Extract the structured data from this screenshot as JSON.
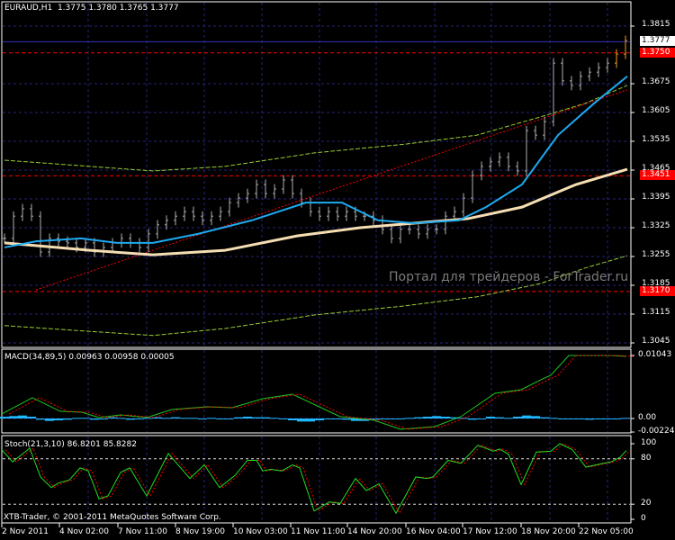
{
  "header": {
    "symbol": "EURAUD,H1",
    "open": "1.3775",
    "high": "1.3780",
    "low": "1.3765",
    "close": "1.3777"
  },
  "watermark": "Портал для трейдеров - ForTrader.ru",
  "copyright": "XTB-Trader, © 2001-2011 MetaQuotes Software Corp.",
  "colors": {
    "bars": "#b0b0b0",
    "fast_ma": "#1eaaf0",
    "slow_ma": "#f5deb3",
    "bands": "#9acd32",
    "levels": "#ff0000",
    "grid": "#25257a",
    "macd": "#1ec81e",
    "hist": "#20b8ff",
    "signal": "#ff0000"
  },
  "chart_data": [
    {
      "type": "ohlc",
      "title": "EURAUD,H1",
      "ylim": [
        1.3045,
        1.3815
      ],
      "yticks": [
        "1.3815",
        "1.3675",
        "1.3605",
        "1.3535",
        "1.3465",
        "1.3395",
        "1.3325",
        "1.3255",
        "1.3185",
        "1.3115",
        "1.3045"
      ],
      "xticks": [
        "2 Nov 2011",
        "4 Nov 02:00",
        "7 Nov 11:00",
        "8 Nov 19:00",
        "10 Nov 03:00",
        "11 Nov 11:00",
        "14 Nov 20:00",
        "16 Nov 04:00",
        "17 Nov 12:00",
        "18 Nov 20:00",
        "22 Nov 05:00"
      ],
      "closes": [
        1.3299,
        1.3353,
        1.3371,
        1.3353,
        1.3266,
        1.3299,
        1.3292,
        1.3288,
        1.3277,
        1.3288,
        1.3266,
        1.3277,
        1.3288,
        1.3299,
        1.3288,
        1.3277,
        1.331,
        1.3332,
        1.3343,
        1.3353,
        1.3364,
        1.3353,
        1.3343,
        1.3353,
        1.3364,
        1.3386,
        1.3397,
        1.3408,
        1.343,
        1.3408,
        1.3419,
        1.3441,
        1.3408,
        1.3386,
        1.3364,
        1.3353,
        1.3364,
        1.3353,
        1.3364,
        1.3353,
        1.3353,
        1.3343,
        1.3321,
        1.3299,
        1.3321,
        1.3321,
        1.331,
        1.3321,
        1.3321,
        1.3353,
        1.3364,
        1.3397,
        1.3452,
        1.3474,
        1.3485,
        1.3496,
        1.3474,
        1.3463,
        1.3561,
        1.355,
        1.3583,
        1.3725,
        1.3682,
        1.3671,
        1.3693,
        1.3703,
        1.3714,
        1.3725,
        1.3747,
        1.378
      ],
      "fast_ma": [
        [
          0,
          1.3277
        ],
        [
          3.5,
          1.3292
        ],
        [
          8.5,
          1.3299
        ],
        [
          12.5,
          1.3288
        ],
        [
          16.5,
          1.3288
        ],
        [
          21.5,
          1.331
        ],
        [
          27.5,
          1.3343
        ],
        [
          33.5,
          1.3386
        ],
        [
          37.5,
          1.3386
        ],
        [
          41.5,
          1.3343
        ],
        [
          45.5,
          1.3336
        ],
        [
          50.5,
          1.3343
        ],
        [
          53.5,
          1.3375
        ],
        [
          57.5,
          1.343
        ],
        [
          61.5,
          1.355
        ],
        [
          65.5,
          1.3627
        ],
        [
          69.2,
          1.3693
        ]
      ],
      "slow_ma": [
        [
          0,
          1.3288
        ],
        [
          9.5,
          1.327
        ],
        [
          16.5,
          1.3259
        ],
        [
          24.5,
          1.327
        ],
        [
          32.5,
          1.3305
        ],
        [
          39.5,
          1.3325
        ],
        [
          45.5,
          1.3336
        ],
        [
          51.5,
          1.3347
        ],
        [
          57.5,
          1.3375
        ],
        [
          63.5,
          1.343
        ],
        [
          69.2,
          1.3467
        ]
      ],
      "upper_band": [
        [
          0,
          1.3489
        ],
        [
          9.5,
          1.3474
        ],
        [
          16.5,
          1.3463
        ],
        [
          24.5,
          1.3474
        ],
        [
          34.5,
          1.3507
        ],
        [
          44.5,
          1.3528
        ],
        [
          52.5,
          1.355
        ],
        [
          59.5,
          1.3594
        ],
        [
          64.5,
          1.3627
        ],
        [
          69.2,
          1.3671
        ]
      ],
      "lower_band": [
        [
          0,
          1.3087
        ],
        [
          9.5,
          1.3073
        ],
        [
          16.5,
          1.3063
        ],
        [
          24.5,
          1.308
        ],
        [
          34.5,
          1.3113
        ],
        [
          44.5,
          1.3135
        ],
        [
          52.5,
          1.3157
        ],
        [
          59.5,
          1.3189
        ],
        [
          64.5,
          1.3227
        ],
        [
          69.2,
          1.3257
        ]
      ],
      "trendline": [
        [
          3.5,
          1.3174
        ],
        [
          69.2,
          1.366
        ]
      ],
      "price_line": {
        "value": 1.3777,
        "label": "1.3777"
      },
      "levels": [
        {
          "value": 1.375,
          "label": "1.3750"
        },
        {
          "value": 1.3451,
          "label": "1.3451"
        },
        {
          "value": 1.317,
          "label": "1.3170"
        }
      ]
    },
    {
      "type": "line",
      "title": "MACD(34,89,5) 0.00963 0.00958 0.00005",
      "ylim": [
        -0.00224,
        0.01043
      ],
      "yticks": [
        "0.01043",
        "0.00",
        "-0.00224"
      ],
      "macd": [
        [
          -0.3,
          0.00075
        ],
        [
          3.1,
          0.00343
        ],
        [
          6.2,
          0.00119
        ],
        [
          8.6,
          0.00104
        ],
        [
          10.5,
          0.00015
        ],
        [
          12.9,
          0.0006
        ],
        [
          15.8,
          0.00015
        ],
        [
          18.6,
          0.00149
        ],
        [
          22.5,
          0.00194
        ],
        [
          25.3,
          0.00179
        ],
        [
          28.7,
          0.00328
        ],
        [
          32,
          0.00402
        ],
        [
          37.3,
          0.0003
        ],
        [
          41.1,
          -0.0003
        ],
        [
          44,
          -0.00179
        ],
        [
          47.8,
          -0.00134
        ],
        [
          50.7,
          0.0003
        ],
        [
          54.5,
          0.00417
        ],
        [
          57.4,
          0.00477
        ],
        [
          59.8,
          0.00656
        ],
        [
          60.7,
          0.00715
        ],
        [
          62.7,
          0.01043
        ],
        [
          67.4,
          0.01043
        ],
        [
          69.1,
          0.01028
        ]
      ],
      "histogram": [
        0.0003,
        0.0004,
        0.0005,
        0.0003,
        -0.0002,
        -0.0004,
        -0.0003,
        -0.0002,
        0.0001,
        0.0001,
        -0.0002,
        -0.0001,
        0.0002,
        0.0001,
        -0.0002,
        -0.0001,
        0.0001,
        0.0002,
        0.0001,
        0.0002,
        0.0001,
        0.0001,
        -0.0001,
        0.0001,
        -0.0001,
        0,
        0.0002,
        0.0003,
        0.0002,
        0.0002,
        0.0001,
        -0.0001,
        -0.0003,
        -0.0005,
        -0.0005,
        -0.0003,
        -0.0001,
        0,
        -0.0002,
        -0.0004,
        -0.0004,
        -0.0002,
        0,
        0,
        0,
        0.0001,
        0.0002,
        0.0003,
        0.0004,
        0.0003,
        0.0002,
        0.0001,
        -0.0002,
        0,
        0.0003,
        0.0002,
        0.0001,
        0.0003,
        0.0005,
        0.0004,
        0.0002,
        0.0001,
        -0.0001,
        0,
        -0.0001,
        -0.0002,
        -0.0001,
        0,
        0,
        0.0001
      ]
    },
    {
      "type": "line",
      "title": "Stoch(21,3,10) 86.8201 85.8282",
      "ylim": [
        0,
        100
      ],
      "yticks": [
        "100",
        "80",
        "20",
        "0"
      ],
      "levels": [
        80,
        20
      ],
      "main": [
        [
          -0.3,
          92
        ],
        [
          0.9,
          76
        ],
        [
          2.8,
          94
        ],
        [
          4.0,
          56
        ],
        [
          5.2,
          42
        ],
        [
          6.0,
          48
        ],
        [
          7.2,
          52
        ],
        [
          8.4,
          68
        ],
        [
          9.3,
          64
        ],
        [
          10.5,
          27
        ],
        [
          11.5,
          31
        ],
        [
          12.9,
          62
        ],
        [
          13.9,
          68
        ],
        [
          15.8,
          31
        ],
        [
          18.2,
          87
        ],
        [
          20.6,
          54
        ],
        [
          22.2,
          72
        ],
        [
          23.9,
          42
        ],
        [
          25.6,
          58
        ],
        [
          27.0,
          78
        ],
        [
          28.0,
          78
        ],
        [
          28.7,
          64
        ],
        [
          29.6,
          66
        ],
        [
          30.8,
          64
        ],
        [
          32.0,
          72
        ],
        [
          32.8,
          68
        ],
        [
          34.4,
          11
        ],
        [
          36.1,
          23
        ],
        [
          37.3,
          21
        ],
        [
          39.0,
          54
        ],
        [
          40.2,
          38
        ],
        [
          41.6,
          47
        ],
        [
          43.5,
          8
        ],
        [
          45.7,
          56
        ],
        [
          46.9,
          54
        ],
        [
          47.6,
          56
        ],
        [
          49.3,
          78
        ],
        [
          50.7,
          74
        ],
        [
          52.6,
          98
        ],
        [
          54.3,
          90
        ],
        [
          55.0,
          93
        ],
        [
          56.0,
          86
        ],
        [
          57.4,
          46
        ],
        [
          59.1,
          89
        ],
        [
          60.7,
          90
        ],
        [
          61.7,
          100
        ],
        [
          63.1,
          92
        ],
        [
          64.6,
          69
        ],
        [
          66.5,
          74
        ],
        [
          67.4,
          76
        ],
        [
          68.4,
          82
        ],
        [
          69.1,
          91
        ]
      ]
    }
  ]
}
